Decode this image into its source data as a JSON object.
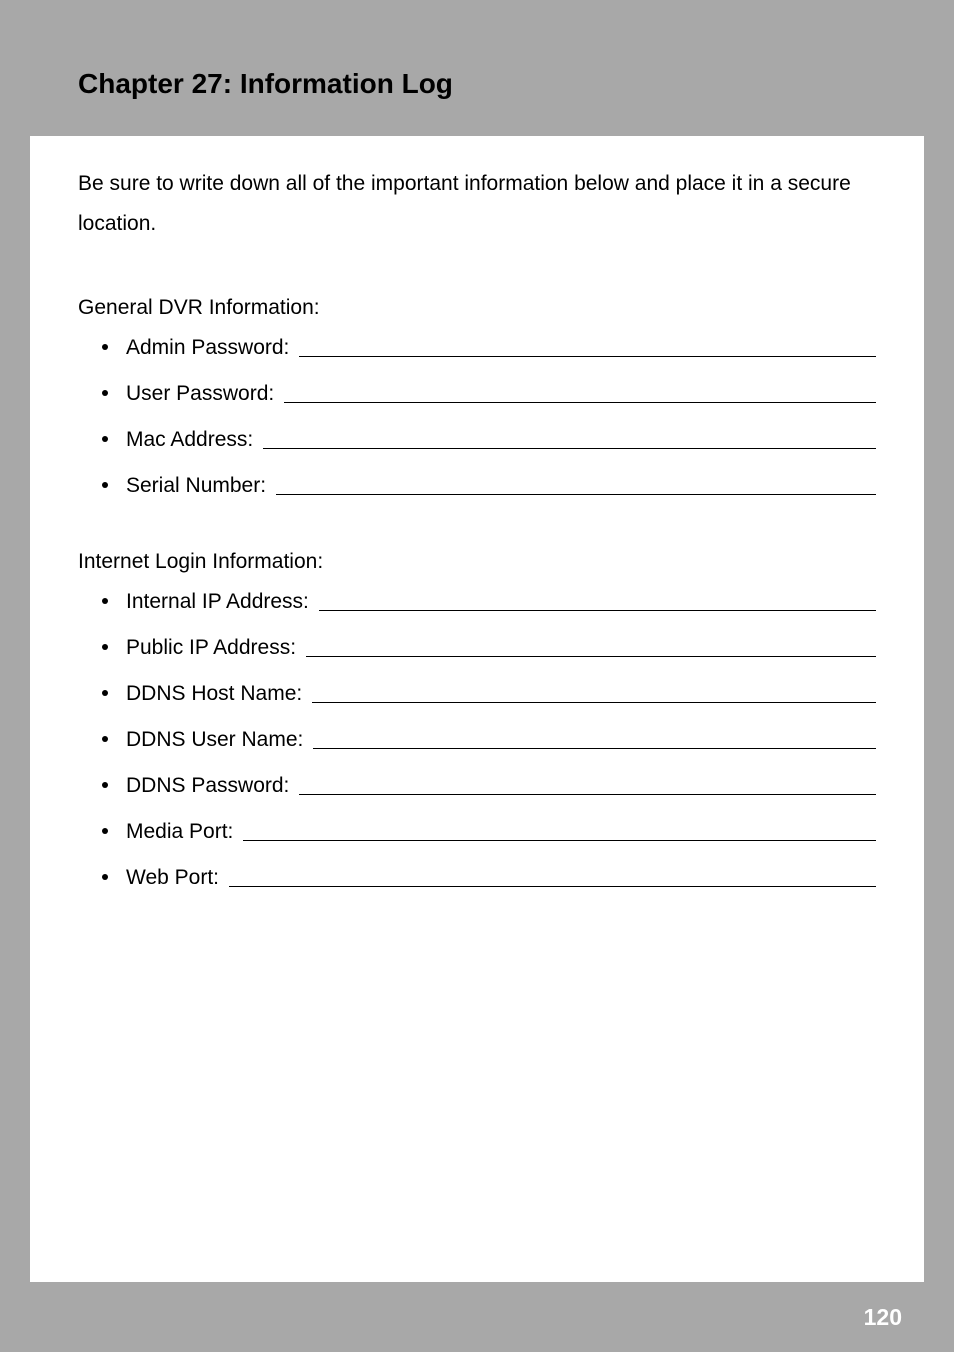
{
  "chapter": {
    "title": "Chapter 27: Information Log"
  },
  "intro": "Be sure to write down all of the important information below and place it in a secure location.",
  "sections": [
    {
      "heading": "General DVR Information:",
      "items": [
        "Admin Password:",
        "User Password:",
        "Mac Address:",
        "Serial Number:"
      ]
    },
    {
      "heading": "Internet Login Information:",
      "items": [
        "Internal IP Address:",
        "Public IP Address:",
        "DDNS Host Name:",
        "DDNS User Name:",
        "DDNS Password:",
        "Media Port:",
        "Web Port:"
      ]
    }
  ],
  "page_number": "120"
}
